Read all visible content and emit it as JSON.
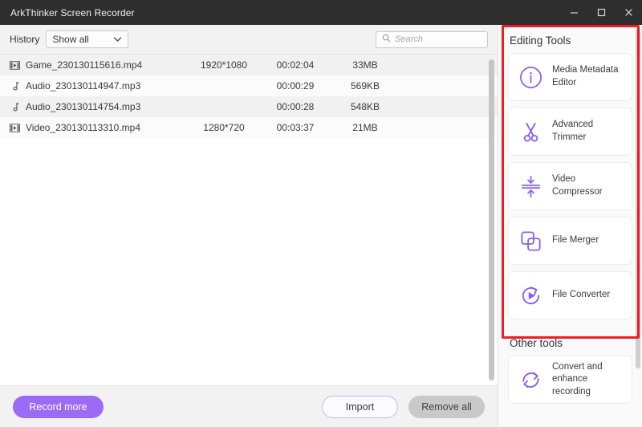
{
  "window": {
    "title": "ArkThinker Screen Recorder",
    "controls": [
      {
        "name": "minimize",
        "glyph": "minimize-icon"
      },
      {
        "name": "maximize",
        "glyph": "maximize-icon"
      },
      {
        "name": "close",
        "glyph": "close-icon"
      }
    ]
  },
  "toolbar": {
    "history_label": "History",
    "history_value": "Show all",
    "history_options": [
      "Show all"
    ],
    "dropdown_icon": "chevron-down-icon",
    "search_placeholder": "Search",
    "search_value": "",
    "search_icon": "search-icon"
  },
  "file_list": {
    "rows": [
      {
        "icon": "video-file-icon",
        "name": "Game_230130115616.mp4",
        "resolution": "1920*1080",
        "duration": "00:02:04",
        "size": "33MB",
        "shaded": true
      },
      {
        "icon": "audio-file-icon",
        "name": "Audio_230130114947.mp3",
        "resolution": "",
        "duration": "00:00:29",
        "size": "569KB",
        "shaded": false
      },
      {
        "icon": "audio-file-icon",
        "name": "Audio_230130114754.mp3",
        "resolution": "",
        "duration": "00:00:28",
        "size": "548KB",
        "shaded": true
      },
      {
        "icon": "video-file-icon",
        "name": "Video_230130113310.mp4",
        "resolution": "1280*720",
        "duration": "00:03:37",
        "size": "21MB",
        "shaded": false
      }
    ]
  },
  "bottom_bar": {
    "record_more": "Record more",
    "import": "Import",
    "remove_all": "Remove all"
  },
  "sidebar": {
    "editing_tools_title": "Editing Tools",
    "editing_tools": [
      {
        "icon": "info-circle-icon",
        "label": "Media Metadata Editor"
      },
      {
        "icon": "scissors-icon",
        "label": "Advanced Trimmer"
      },
      {
        "icon": "compress-icon",
        "label": "Video Compressor"
      },
      {
        "icon": "merge-squares-icon",
        "label": "File Merger"
      },
      {
        "icon": "convert-play-icon",
        "label": "File Converter"
      }
    ],
    "other_tools_title": "Other tools",
    "other_tools": [
      {
        "icon": "refresh-circle-icon",
        "label": "Convert and enhance recording"
      }
    ]
  },
  "colors": {
    "accent_purple": "#9b6bf5",
    "icon_purple": "#8b5cf6",
    "annotation_red": "#ee1c24",
    "titlebar": "#2e2e2e"
  }
}
